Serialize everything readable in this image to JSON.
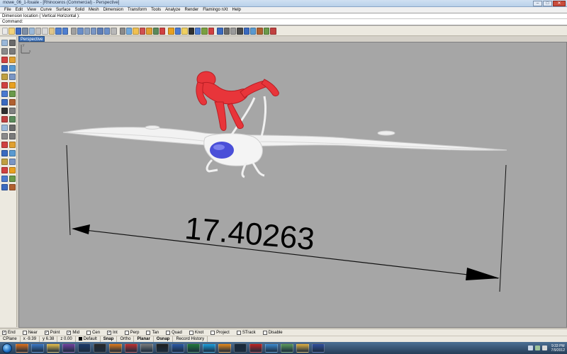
{
  "window": {
    "title": "mowe_06_1-fouale - [Rhinoceros (Commercial) - Perspective]",
    "buttons": [
      "–",
      "□",
      "✕"
    ]
  },
  "menu": [
    "File",
    "Edit",
    "View",
    "Curve",
    "Surface",
    "Solid",
    "Mesh",
    "Dimension",
    "Transform",
    "Tools",
    "Analyze",
    "Render",
    "Flamingo nXt",
    "Help"
  ],
  "command_history": "Dimension location ( Vertical  Horizontal ):",
  "command_prompt": {
    "label": "Command:",
    "value": ""
  },
  "toolbar_icons": [
    "new-icon",
    "open-icon",
    "save-icon",
    "print-icon",
    "import-icon",
    "cut-icon",
    "copy-icon",
    "paste-icon",
    "undo-icon",
    "redo-icon",
    "pan-icon",
    "rotate-view-icon",
    "zoom-icon",
    "zoom-window-icon",
    "zoom-extents-icon",
    "zoom-selected-icon",
    "undo-view-icon",
    "select-icon",
    "cplane-icon",
    "hide-icon",
    "show-icon",
    "lock-icon",
    "layer-icon",
    "properties-icon",
    "render-icon",
    "material-icon",
    "light-icon",
    "text-icon",
    "dimension-icon",
    "grid-icon",
    "snap-icon",
    "help-icon",
    "options-icon",
    "mesh-icon",
    "point-icon",
    "curve-icon",
    "surface-icon",
    "solid-icon",
    "analyze-icon",
    "flamingo-icon"
  ],
  "viewport": {
    "name": "Perspective",
    "dimension_value": "17.40263",
    "axis_labels": {
      "x": "x",
      "y": "y"
    }
  },
  "osnaps": [
    {
      "label": "End",
      "checked": true
    },
    {
      "label": "Near",
      "checked": false
    },
    {
      "label": "Point",
      "checked": true
    },
    {
      "label": "Mid",
      "checked": true
    },
    {
      "label": "Cen",
      "checked": false
    },
    {
      "label": "Int",
      "checked": true
    },
    {
      "label": "Perp",
      "checked": false
    },
    {
      "label": "Tan",
      "checked": false
    },
    {
      "label": "Quad",
      "checked": false
    },
    {
      "label": "Knot",
      "checked": false
    },
    {
      "label": "Project",
      "checked": false
    },
    {
      "label": "STrack",
      "checked": false
    },
    {
      "label": "Disable",
      "checked": false
    }
  ],
  "status": {
    "cplane": "CPlane",
    "x": "x -9.39",
    "y": "y 6.38",
    "z": "z 0.00",
    "layer": "Default",
    "snap": "Snap",
    "ortho": "Ortho",
    "planar": "Planar",
    "osnap": "Osnap",
    "record_history": "Record History"
  },
  "taskbar": {
    "apps": [
      "firefox-icon",
      "explorer-icon",
      "folder-icon",
      "media-player-icon",
      "photoshop-icon",
      "illustrator-icon",
      "blender-icon",
      "sketchup-icon",
      "rhino-icon",
      "zbrush-icon",
      "word-icon",
      "excel-icon",
      "skype-icon",
      "vlc-icon",
      "steam-icon",
      "pdf-icon",
      "mail-icon",
      "network-icon",
      "chrome-icon",
      "screen-icon"
    ],
    "time": "9:33 PM",
    "date": "7/9/2012"
  },
  "colors": {
    "viewport_bg": "#a6a6a6",
    "figure": "#e8353a",
    "glider": "#f2f2f2",
    "canopy": "#4a4fd8",
    "viewport_tab": "#3b6fb5"
  }
}
